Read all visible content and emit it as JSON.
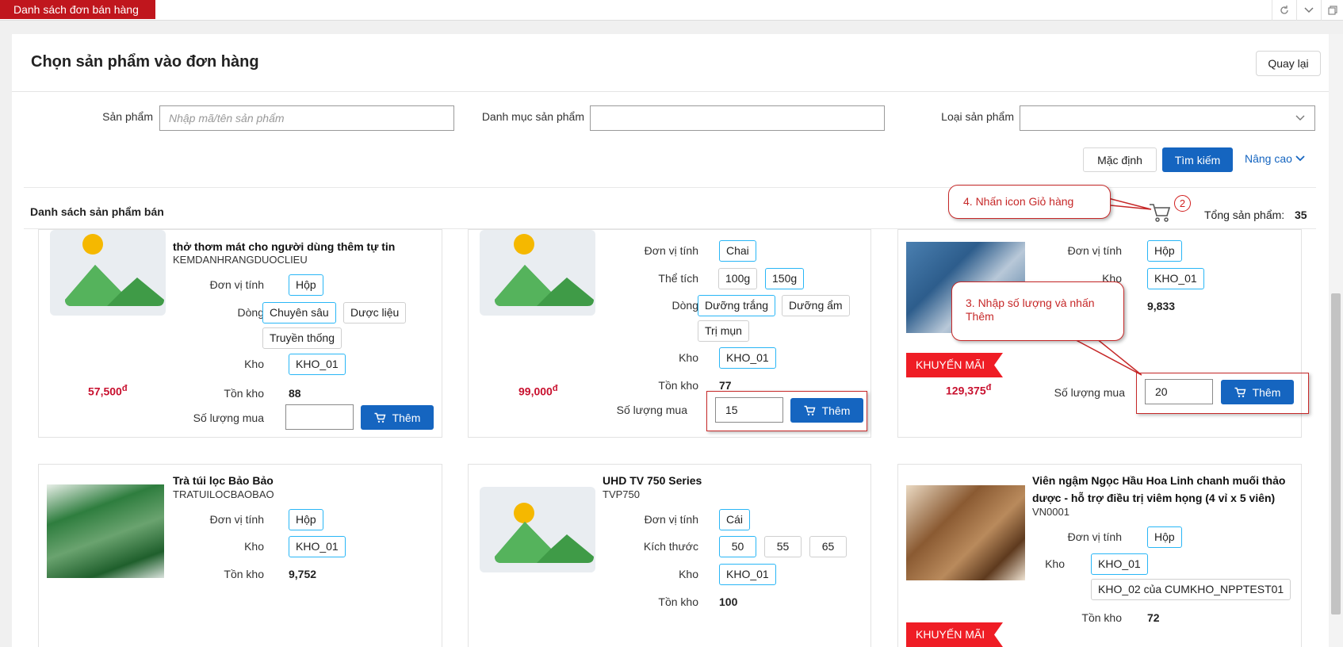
{
  "window": {
    "tab_title": "Danh sách đơn bán hàng"
  },
  "page": {
    "title": "Chọn sản phẩm vào đơn hàng",
    "back_label": "Quay lại"
  },
  "filters": {
    "product_label": "Sản phẩm",
    "product_placeholder": "Nhập mã/tên sản phẩm",
    "category_label": "Danh mục sản phẩm",
    "category_value": "",
    "type_label": "Loại sản phẩm",
    "type_value": "",
    "default_label": "Mặc định",
    "search_label": "Tìm kiếm",
    "advanced_label": "Nâng cao"
  },
  "list": {
    "title": "Danh sách sản phẩm bán",
    "total_label": "Tổng sản phẩm:",
    "total_value": "35",
    "cart_count": "2"
  },
  "callouts": {
    "cart": "4. Nhấn icon Giỏ hàng",
    "add": "3. Nhập số lượng và nhấn Thêm"
  },
  "labels": {
    "unit": "Đơn vị tính",
    "line": "Dòng",
    "volume": "Thể tích",
    "size": "Kích thước",
    "warehouse": "Kho",
    "stock": "Tồn kho",
    "qty": "Số lượng mua",
    "add": "Thêm",
    "promo": "KHUYẾN MÃI",
    "currency": "đ"
  },
  "products": [
    {
      "name": "thở thơm mát cho người dùng thêm tự tin",
      "code": "KEMDANHRANGDUOCLIEU",
      "unit": "Hộp",
      "lines": [
        "Chuyên sâu",
        "Dược liệu",
        "Truyền thống"
      ],
      "warehouse": "KHO_01",
      "stock": "88",
      "price": "57,500",
      "qty": ""
    },
    {
      "unit": "Chai",
      "volumes": [
        "100g",
        "150g"
      ],
      "lines": [
        "Dưỡng trắng",
        "Dưỡng ẩm",
        "Trị mụn"
      ],
      "warehouse": "KHO_01",
      "stock": "77",
      "price": "99,000",
      "qty": "15"
    },
    {
      "unit": "Hộp",
      "warehouse": "KHO_01",
      "stock": "9,833",
      "price": "129,375",
      "qty": "20"
    },
    {
      "name": "Trà túi lọc Bảo Bảo",
      "code": "TRATUILOCBAOBAO",
      "unit": "Hộp",
      "warehouse": "KHO_01",
      "stock": "9,752"
    },
    {
      "name": "UHD TV 750 Series",
      "code": "TVP750",
      "unit": "Cái",
      "sizes": [
        "50",
        "55",
        "65"
      ],
      "warehouse": "KHO_01",
      "stock": "100"
    },
    {
      "name": "Viên ngậm Ngọc Hầu Hoa Linh chanh muối thảo dược - hỗ trợ điều trị viêm họng (4 vỉ x 5 viên)",
      "code": "VN0001",
      "unit": "Hộp",
      "warehouses": [
        "KHO_01",
        "KHO_02 của CUMKHO_NPPTEST01"
      ],
      "stock": "72"
    }
  ],
  "colors": {
    "brand_red": "#c0161d",
    "primary_blue": "#1565c0",
    "price_red": "#c8102e",
    "selected_border": "#29b6f6"
  },
  "icons": [
    "refresh-icon",
    "chevron-down-icon",
    "restore-window-icon",
    "cart-icon",
    "image-placeholder-icon"
  ]
}
